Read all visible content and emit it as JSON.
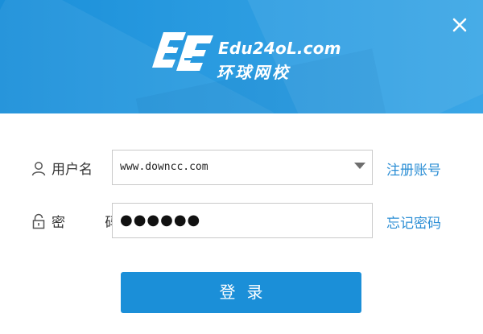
{
  "window": {
    "close_icon": "close-icon"
  },
  "brand": {
    "name_en": "Edu24oL.com",
    "name_cn": "环球网校",
    "logo_icon": "edu24ol-logo-icon",
    "header_color": "#2196dc"
  },
  "form": {
    "username": {
      "label": "用户名",
      "icon": "user-icon",
      "value": "www.downcc.com",
      "dropdown_icon": "dropdown-arrow-icon"
    },
    "password": {
      "label": "密 码",
      "icon": "lock-icon",
      "value": "●●●●●●"
    },
    "register_link": "注册账号",
    "forgot_link": "忘记密码",
    "login_button": "登录"
  },
  "colors": {
    "accent": "#1b8fd8",
    "link": "#2d8fd5"
  }
}
